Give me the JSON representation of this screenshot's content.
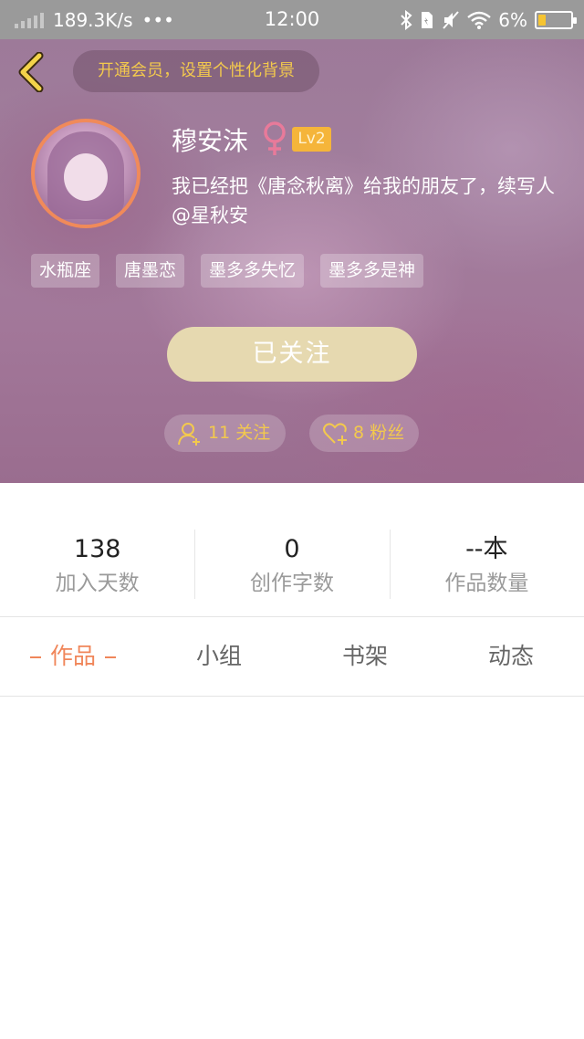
{
  "status_bar": {
    "network_speed": "189.3K/s",
    "dots": "•••",
    "time": "12:00",
    "battery_percent": "6%",
    "battery_level": 0.06
  },
  "header": {
    "vip_banner": "开通会员，设置个性化背景",
    "username": "穆安沫",
    "level": "Lv2",
    "bio": "我已经把《唐念秋离》给我的朋友了，续写人@星秋安",
    "tags": [
      "水瓶座",
      "唐墨恋",
      "墨多多失忆",
      "墨多多是神"
    ],
    "follow_button": "已关注",
    "following_label": "11 关注",
    "fans_label": "8 粉丝"
  },
  "stats": [
    {
      "value": "138",
      "label": "加入天数"
    },
    {
      "value": "0",
      "label": "创作字数"
    },
    {
      "value": "--本",
      "label": "作品数量"
    }
  ],
  "tabs": [
    {
      "label": "作品",
      "active": true
    },
    {
      "label": "小组",
      "active": false
    },
    {
      "label": "书架",
      "active": false
    },
    {
      "label": "动态",
      "active": false
    }
  ],
  "colors": {
    "accent_orange": "#f0865a",
    "gold": "#f3c94d",
    "follow_button": "#e6d9b0",
    "gender_pink": "#e87a9a"
  }
}
